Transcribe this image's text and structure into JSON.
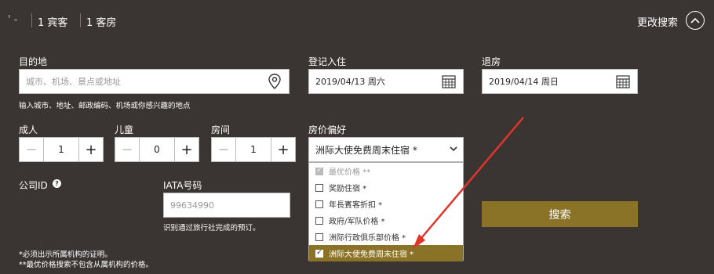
{
  "topbar": {
    "partial_text": "' -",
    "guests": "1 宾客",
    "rooms": "1 客房",
    "modify_search": "更改搜索"
  },
  "destination": {
    "label": "目的地",
    "placeholder": "城市、机场、景点或地址",
    "hint": "输入城市、地址、邮政编码、机场或你感兴趣的地点"
  },
  "checkin": {
    "label": "登记入住",
    "value": "2019/04/13 周六"
  },
  "checkout": {
    "label": "退房",
    "value": "2019/04/14 周日"
  },
  "adults": {
    "label": "成人",
    "value": "1",
    "minus": "−",
    "plus": "+"
  },
  "children": {
    "label": "儿童",
    "value": "0",
    "minus": "−",
    "plus": "+"
  },
  "rooms": {
    "label": "房间",
    "value": "1",
    "minus": "−",
    "plus": "+"
  },
  "rate": {
    "label": "房价偏好",
    "selected": "洲际大使免费周末住宿 *",
    "options": [
      "最优价格 **",
      "奖励住宿 *",
      "年長賓客折扣 *",
      "政府/军队价格 *",
      "洲际行政俱乐部价格 *",
      "洲际大使免费周末住宿 *"
    ]
  },
  "corp": {
    "label": "公司ID",
    "help": "?"
  },
  "iata": {
    "label": "IATA号码",
    "value": "99634990",
    "hint": "识别通过旅行社完成的预订。"
  },
  "search": {
    "label": "搜索"
  },
  "notes": {
    "line1": "*必须出示所属机构的证明。",
    "line2": "**最优价格搜索不包含从属机构的价格。"
  },
  "colors": {
    "background": "#3a3533",
    "accent": "#8a7227",
    "arrow": "#e0352b"
  }
}
